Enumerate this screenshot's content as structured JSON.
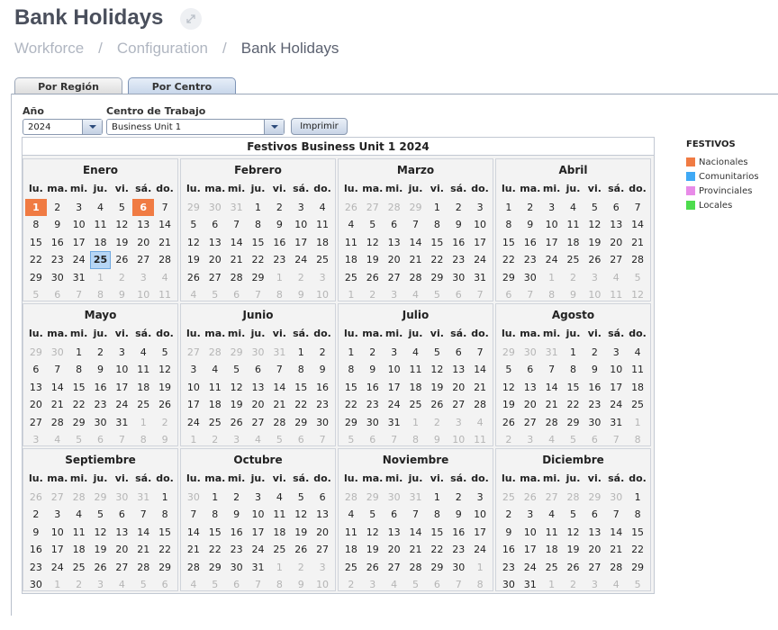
{
  "header": {
    "title": "Bank Holidays",
    "breadcrumb": [
      "Workforce",
      "Configuration",
      "Bank Holidays"
    ]
  },
  "tabs": [
    {
      "label": "Por Región",
      "active": false
    },
    {
      "label": "Por Centro",
      "active": true
    }
  ],
  "filters": {
    "year_label": "Año",
    "year_value": "2024",
    "center_label": "Centro de Trabajo",
    "center_value": "Business Unit 1",
    "print_label": "Imprimir"
  },
  "calendar": {
    "title": "Festivos Business Unit 1 2024",
    "weekdays": [
      "lu.",
      "ma.",
      "mi.",
      "ju.",
      "vi.",
      "sá.",
      "do."
    ],
    "months": [
      {
        "name": "Enero",
        "lead": [],
        "days": 31,
        "trail": [
          1,
          2,
          3,
          4,
          5,
          6,
          7,
          8,
          9,
          10,
          11
        ],
        "holidays_nac": [
          1,
          6
        ],
        "today": 25
      },
      {
        "name": "Febrero",
        "lead": [
          29,
          30,
          31
        ],
        "days": 29,
        "trail": [
          1,
          2,
          3,
          4,
          5,
          6,
          7,
          8,
          9,
          10
        ],
        "holidays_nac": [],
        "today": null
      },
      {
        "name": "Marzo",
        "lead": [
          26,
          27,
          28,
          29
        ],
        "days": 31,
        "trail": [
          1,
          2,
          3,
          4,
          5,
          6,
          7
        ],
        "holidays_nac": [],
        "today": null
      },
      {
        "name": "Abril",
        "lead": [],
        "days": 30,
        "trail": [
          1,
          2,
          3,
          4,
          5,
          6,
          7,
          8,
          9,
          10,
          11,
          12
        ],
        "holidays_nac": [],
        "today": null
      },
      {
        "name": "Mayo",
        "lead": [
          29,
          30
        ],
        "days": 31,
        "trail": [
          1,
          2,
          3,
          4,
          5,
          6,
          7,
          8,
          9
        ],
        "holidays_nac": [],
        "today": null
      },
      {
        "name": "Junio",
        "lead": [
          27,
          28,
          29,
          30,
          31
        ],
        "days": 30,
        "trail": [
          1,
          2,
          3,
          4,
          5,
          6,
          7
        ],
        "holidays_nac": [],
        "today": null
      },
      {
        "name": "Julio",
        "lead": [],
        "days": 31,
        "trail": [
          1,
          2,
          3,
          4,
          5,
          6,
          7,
          8,
          9,
          10,
          11
        ],
        "holidays_nac": [],
        "today": null
      },
      {
        "name": "Agosto",
        "lead": [
          29,
          30,
          31
        ],
        "days": 31,
        "trail": [
          1,
          2,
          3,
          4,
          5,
          6,
          7,
          8
        ],
        "holidays_nac": [],
        "today": null
      },
      {
        "name": "Septiembre",
        "lead": [
          26,
          27,
          28,
          29,
          30,
          31
        ],
        "days": 30,
        "trail": [
          1,
          2,
          3,
          4,
          5,
          6
        ],
        "holidays_nac": [],
        "today": null
      },
      {
        "name": "Octubre",
        "lead": [
          30
        ],
        "days": 31,
        "trail": [
          1,
          2,
          3,
          4,
          5,
          6,
          7,
          8,
          9,
          10
        ],
        "holidays_nac": [],
        "today": null
      },
      {
        "name": "Noviembre",
        "lead": [
          28,
          29,
          30,
          31
        ],
        "days": 30,
        "trail": [
          1,
          2,
          3,
          4,
          5,
          6,
          7,
          8
        ],
        "holidays_nac": [],
        "today": null
      },
      {
        "name": "Diciembre",
        "lead": [
          25,
          26,
          27,
          28,
          29,
          30
        ],
        "days": 31,
        "trail": [
          1,
          2,
          3,
          4,
          5
        ],
        "holidays_nac": [],
        "today": null
      }
    ]
  },
  "legend": {
    "title": "FESTIVOS",
    "items": [
      {
        "label": "Nacionales",
        "color": "#f07b43"
      },
      {
        "label": "Comunitarios",
        "color": "#3fa9f5"
      },
      {
        "label": "Provinciales",
        "color": "#e88be8"
      },
      {
        "label": "Locales",
        "color": "#4ddc4d"
      }
    ]
  }
}
